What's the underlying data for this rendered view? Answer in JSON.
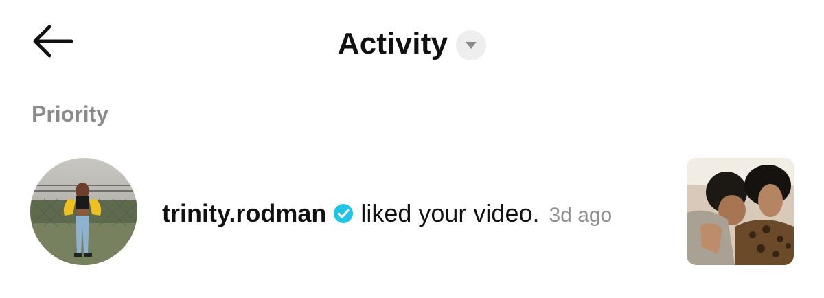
{
  "header": {
    "back_icon": "arrow-left-icon",
    "title": "Activity",
    "dropdown_icon": "caret-down-icon"
  },
  "section": {
    "label": "Priority"
  },
  "notification": {
    "username": "trinity.rodman",
    "verified_icon": "verified-badge-icon",
    "action": "liked your video.",
    "time": "3d ago"
  },
  "colors": {
    "text_primary": "#111111",
    "text_secondary": "#8a8a8a",
    "verified_blue": "#20c5e8",
    "dropdown_bg": "#eeeeee"
  }
}
